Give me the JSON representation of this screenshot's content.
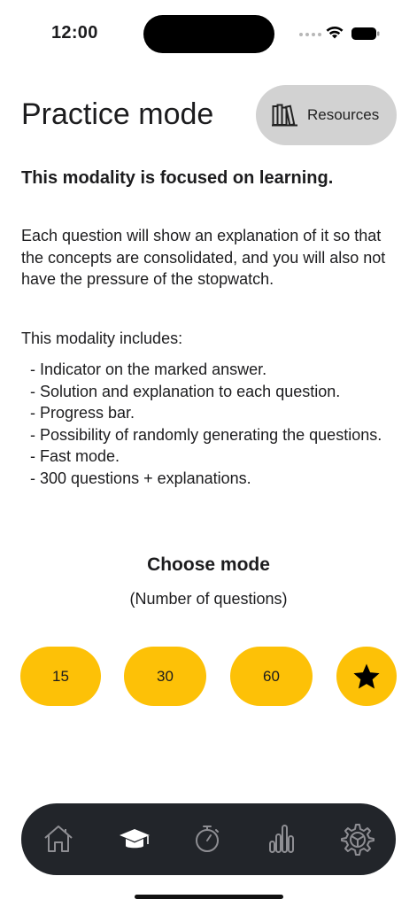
{
  "status_bar": {
    "time": "12:00"
  },
  "header": {
    "title": "Practice mode",
    "resources_label": "Resources"
  },
  "intro": {
    "subtitle": "This modality is focused on learning.",
    "description": "Each question will show an explanation of it so that the concepts are consolidated, and you will also not have the pressure of the stopwatch.",
    "includes_label": "This modality includes:",
    "features": [
      "- Indicator on the marked answer.",
      "- Solution and explanation to each question.",
      "- Progress bar.",
      "- Possibility of randomly generating the questions.",
      "- Fast mode.",
      "- 300 questions + explanations."
    ]
  },
  "mode_selector": {
    "title": "Choose mode",
    "subtitle": "(Number of questions)",
    "options": [
      "15",
      "30",
      "60"
    ],
    "favorite_icon": "star-icon"
  },
  "tab_bar": {
    "items": [
      {
        "icon": "home-icon",
        "active": false
      },
      {
        "icon": "graduation-cap-icon",
        "active": true
      },
      {
        "icon": "stopwatch-icon",
        "active": false
      },
      {
        "icon": "bar-chart-icon",
        "active": false
      },
      {
        "icon": "settings-gear-icon",
        "active": false
      }
    ]
  },
  "colors": {
    "accent": "#fdc107",
    "tabbar_bg": "#22252a",
    "tab_inactive": "#8e8e93",
    "tab_active": "#ffffff",
    "resources_bg": "#d2d2d2"
  }
}
